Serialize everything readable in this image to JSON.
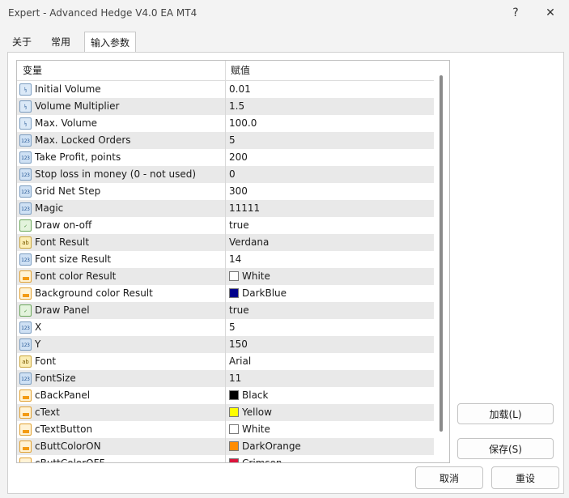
{
  "window": {
    "title": "Expert - Advanced Hedge V4.0 EA MT4",
    "help_label": "?",
    "close_label": "✕"
  },
  "tabs": [
    {
      "label": "关于"
    },
    {
      "label": "常用"
    },
    {
      "label": "输入参数"
    }
  ],
  "grid": {
    "headers": {
      "variable": "变量",
      "value": "赋值"
    },
    "rows": [
      {
        "icon": "double-value-icon",
        "type": "dbl",
        "name": "Initial Volume",
        "value": "0.01"
      },
      {
        "icon": "double-value-icon",
        "type": "dbl",
        "name": "Volume Multiplier",
        "value": "1.5"
      },
      {
        "icon": "double-value-icon",
        "type": "dbl",
        "name": "Max. Volume",
        "value": "100.0"
      },
      {
        "icon": "integer-value-icon",
        "type": "int",
        "name": "Max. Locked Orders",
        "value": "5"
      },
      {
        "icon": "integer-value-icon",
        "type": "int",
        "name": "Take Profit, points",
        "value": "200"
      },
      {
        "icon": "integer-value-icon",
        "type": "int",
        "name": "Stop loss in money (0 - not used)",
        "value": "0"
      },
      {
        "icon": "integer-value-icon",
        "type": "int",
        "name": "Grid Net Step",
        "value": "300"
      },
      {
        "icon": "integer-value-icon",
        "type": "int",
        "name": "Magic",
        "value": "11111"
      },
      {
        "icon": "boolean-value-icon",
        "type": "bool",
        "name": "Draw on-off",
        "value": "true"
      },
      {
        "icon": "string-value-icon",
        "type": "str",
        "name": "Font Result",
        "value": "Verdana"
      },
      {
        "icon": "integer-value-icon",
        "type": "int",
        "name": "Font size Result",
        "value": "14"
      },
      {
        "icon": "color-value-icon",
        "type": "clr",
        "name": "Font color Result",
        "value": "White",
        "swatch": "#ffffff"
      },
      {
        "icon": "color-value-icon",
        "type": "clr",
        "name": "Background color Result",
        "value": "DarkBlue",
        "swatch": "#00008b"
      },
      {
        "icon": "boolean-value-icon",
        "type": "bool",
        "name": "Draw Panel",
        "value": "true"
      },
      {
        "icon": "integer-value-icon",
        "type": "int",
        "name": "X",
        "value": "5"
      },
      {
        "icon": "integer-value-icon",
        "type": "int",
        "name": "Y",
        "value": "150"
      },
      {
        "icon": "string-value-icon",
        "type": "str",
        "name": "Font",
        "value": "Arial"
      },
      {
        "icon": "integer-value-icon",
        "type": "int",
        "name": "FontSize",
        "value": "11"
      },
      {
        "icon": "color-value-icon",
        "type": "clr",
        "name": "cBackPanel",
        "value": "Black",
        "swatch": "#000000"
      },
      {
        "icon": "color-value-icon",
        "type": "clr",
        "name": "cText",
        "value": "Yellow",
        "swatch": "#ffff00"
      },
      {
        "icon": "color-value-icon",
        "type": "clr",
        "name": "cTextButton",
        "value": "White",
        "swatch": "#ffffff"
      },
      {
        "icon": "color-value-icon",
        "type": "clr",
        "name": "cButtColorON",
        "value": "DarkOrange",
        "swatch": "#ff8c00"
      },
      {
        "icon": "color-value-icon",
        "type": "clr",
        "name": "cButtColorOFF",
        "value": "Crimson",
        "swatch": "#dc143c"
      }
    ]
  },
  "buttons": {
    "load": "加载(L)",
    "save": "保存(S)",
    "cancel": "取消",
    "reset": "重设"
  }
}
